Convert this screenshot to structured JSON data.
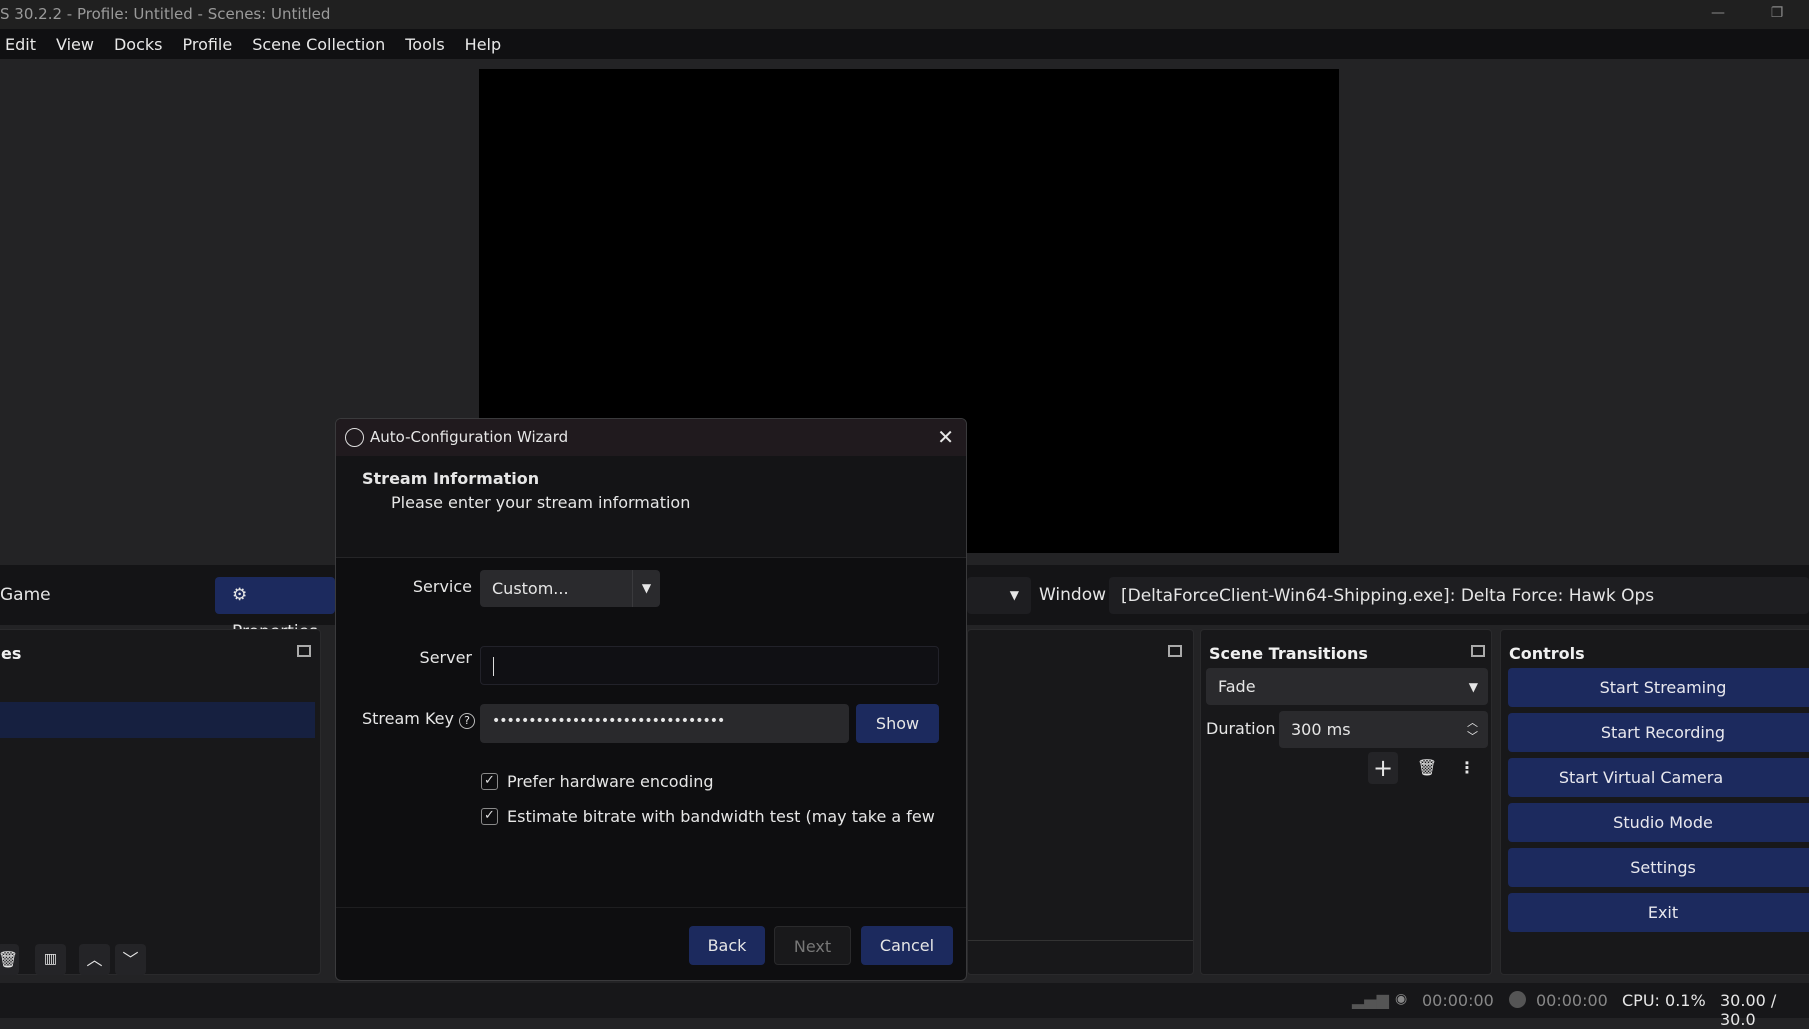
{
  "window": {
    "title": "S 30.2.2 - Profile: Untitled - Scenes: Untitled"
  },
  "menu": [
    "Edit",
    "View",
    "Docks",
    "Profile",
    "Scene Collection",
    "Tools",
    "Help"
  ],
  "source_toolbar": {
    "source_name": "Game",
    "properties_label": "Properties",
    "window_label": "Window",
    "window_value": "[DeltaForceClient-Win64-Shipping.exe]: Delta Force: Hawk Ops"
  },
  "docks": {
    "sources_title": "es",
    "transitions": {
      "title": "Scene Transitions",
      "transition": "Fade",
      "duration_label": "Duration",
      "duration_value": "300 ms"
    },
    "controls": {
      "title": "Controls",
      "buttons": [
        "Start Streaming",
        "Start Recording",
        "Start Virtual Camera",
        "Studio Mode",
        "Settings",
        "Exit"
      ]
    }
  },
  "status": {
    "stream_time": "00:00:00",
    "record_time": "00:00:00",
    "cpu": "CPU: 0.1%",
    "fps": "30.00 / 30.0"
  },
  "dialog": {
    "title": "Auto-Configuration Wizard",
    "heading": "Stream Information",
    "subheading": "Please enter your stream information",
    "service_label": "Service",
    "service_value": "Custom...",
    "server_label": "Server",
    "server_value": "",
    "key_label": "Stream Key",
    "key_value": "••••••••••••••••••••••••••••••••",
    "show_label": "Show",
    "checkboxes": [
      {
        "label": "Prefer hardware encoding",
        "checked": true
      },
      {
        "label": "Estimate bitrate with bandwidth test (may take a few mini",
        "checked": true
      }
    ],
    "back": "Back",
    "next": "Next",
    "cancel": "Cancel"
  },
  "colors": {
    "accent": "#1c2a5e",
    "background": "#232325",
    "dialog": "#0e0e10"
  }
}
